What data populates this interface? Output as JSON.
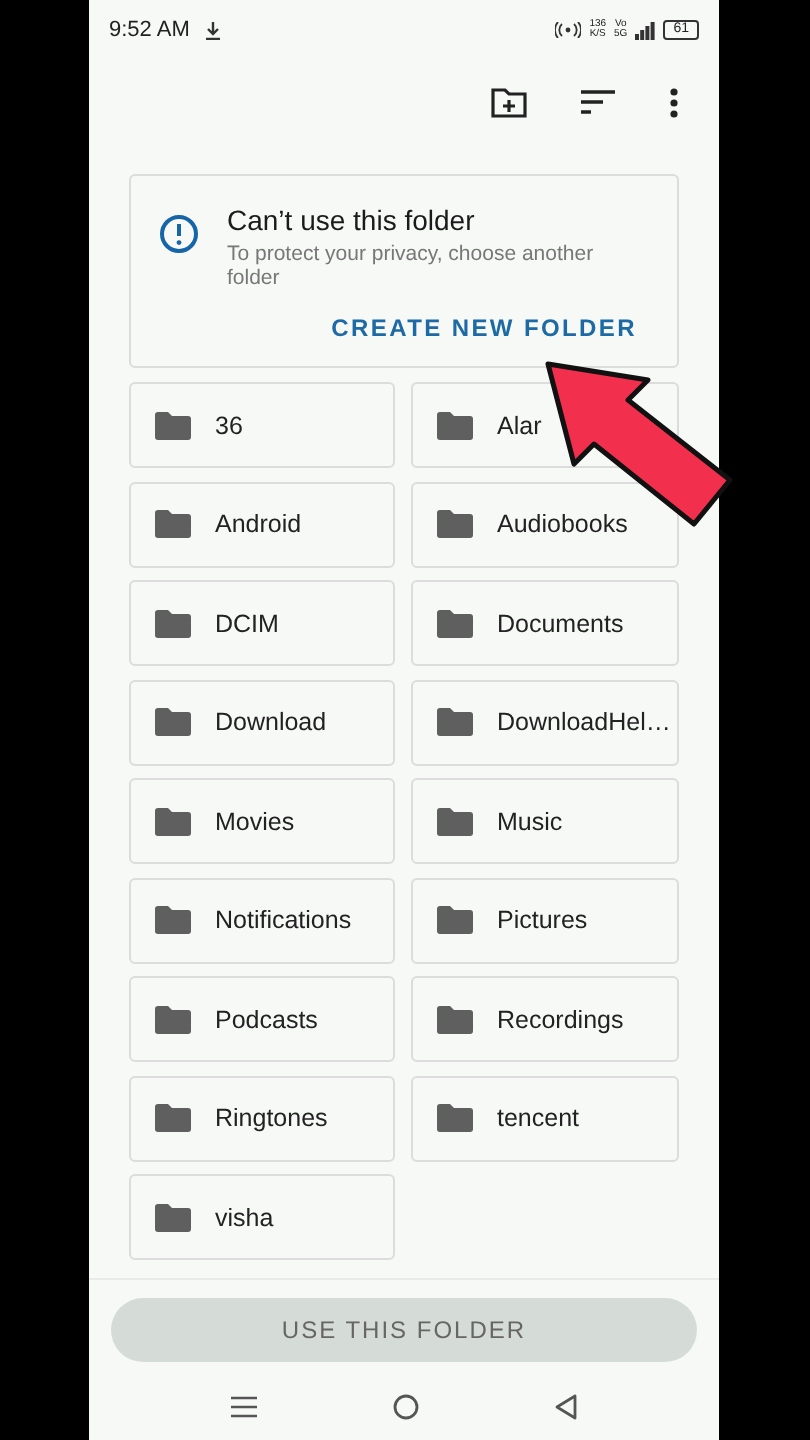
{
  "status_bar": {
    "time": "9:52 AM",
    "net_speed": [
      "136",
      "K/S"
    ],
    "network": [
      "Vo",
      "5G"
    ],
    "battery": "61"
  },
  "notice": {
    "title": "Can’t use this folder",
    "message": "To protect your privacy, choose another folder",
    "action": "CREATE NEW FOLDER"
  },
  "folders": [
    {
      "name": "36"
    },
    {
      "name": "Alar"
    },
    {
      "name": "Android"
    },
    {
      "name": "Audiobooks"
    },
    {
      "name": "DCIM"
    },
    {
      "name": "Documents"
    },
    {
      "name": "Download"
    },
    {
      "name": "DownloadHel…"
    },
    {
      "name": "Movies"
    },
    {
      "name": "Music"
    },
    {
      "name": "Notifications"
    },
    {
      "name": "Pictures"
    },
    {
      "name": "Podcasts"
    },
    {
      "name": "Recordings"
    },
    {
      "name": "Ringtones"
    },
    {
      "name": "tencent"
    },
    {
      "name": "visha"
    }
  ],
  "use_button": {
    "label": "USE THIS FOLDER",
    "disabled": true
  }
}
